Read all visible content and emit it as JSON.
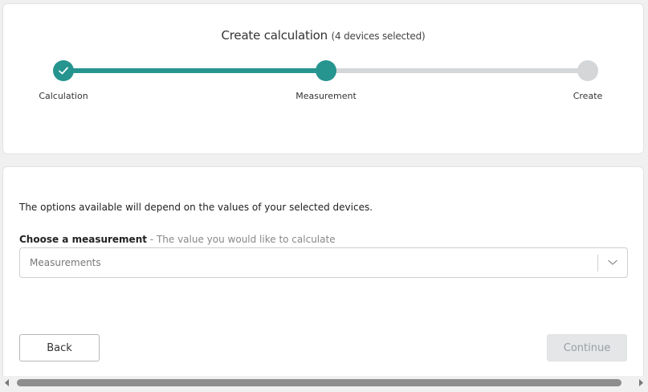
{
  "header": {
    "title": "Create calculation",
    "subtitle": "(4 devices selected)"
  },
  "stepper": {
    "steps": [
      {
        "label": "Calculation",
        "state": "completed"
      },
      {
        "label": "Measurement",
        "state": "current"
      },
      {
        "label": "Create",
        "state": "upcoming"
      }
    ],
    "active_color": "#26948f",
    "inactive_color": "#d4d6d8"
  },
  "form": {
    "info_text": "The options available will depend on the values of your selected devices.",
    "measurement_label": "Choose a measurement",
    "measurement_hint": " - The value you would like to calculate",
    "measurement_placeholder": "Measurements"
  },
  "actions": {
    "back_label": "Back",
    "continue_label": "Continue"
  }
}
